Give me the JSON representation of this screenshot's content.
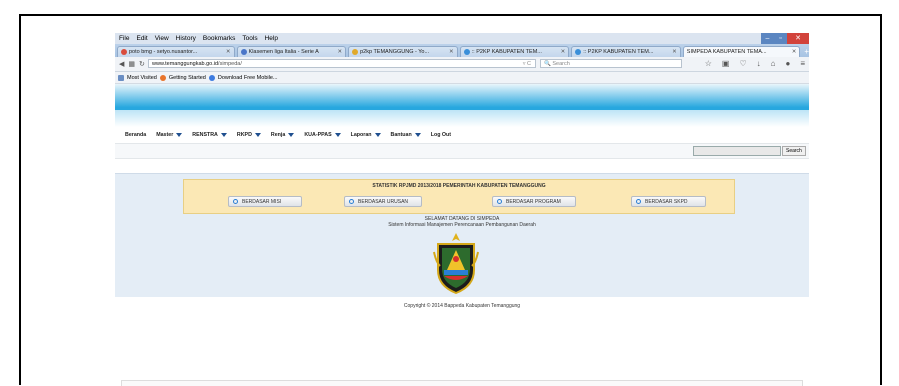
{
  "menu": [
    "File",
    "Edit",
    "View",
    "History",
    "Bookmarks",
    "Tools",
    "Help"
  ],
  "tabs": [
    {
      "label": "poto bmg - setyo.nusantor...",
      "color": "#d94c3d"
    },
    {
      "label": "Klasemen liga Italia - Serie A",
      "color": "#4a76c8"
    },
    {
      "label": "p2kp TEMANGGUNG - Yo...",
      "color": "#e0a92a"
    },
    {
      "label": ":: P2KP KABUPATEN TEM...",
      "color": "#3a8fd9"
    },
    {
      "label": ":: P2KP KABUPATEN TEM...",
      "color": "#3a8fd9"
    },
    {
      "label": "SIMPEDA KABUPATEN TEMA...",
      "color": "#ffffff"
    }
  ],
  "url": {
    "domain": "www.temanggungkab.go.id",
    "path": "/simpeda/"
  },
  "search_placeholder": "Search",
  "bookmarks": [
    "Most Visited",
    "Getting Started",
    "Download Free Mobile..."
  ],
  "site_menu": [
    {
      "label": "Beranda",
      "dropdown": false
    },
    {
      "label": "Master",
      "dropdown": true
    },
    {
      "label": "RENSTRA",
      "dropdown": true
    },
    {
      "label": "RKPD",
      "dropdown": true
    },
    {
      "label": "Renja",
      "dropdown": true
    },
    {
      "label": "KUA-PPAS",
      "dropdown": true
    },
    {
      "label": "Laporan",
      "dropdown": true
    },
    {
      "label": "Bantuan",
      "dropdown": true
    },
    {
      "label": "Log Out",
      "dropdown": false
    }
  ],
  "site_search_button": "Search",
  "stats_title": "STATISTIK RPJMD 2013/2018 PEMERINTAH KABUPATEN TEMANGGUNG",
  "stats_buttons": [
    "BERDASAR MISI",
    "BERDASAR URUSAN",
    "BERDASAR PROGRAM",
    "BERDASAR SKPD"
  ],
  "welcome_title": "SELAMAT DATANG DI SIMPEDA",
  "welcome_sub": "Sistem Informasi Manajemen Perencanaan Pembangunan Daerah",
  "copyright": "Copyright © 2014 Bappeda Kabupaten Temanggung"
}
